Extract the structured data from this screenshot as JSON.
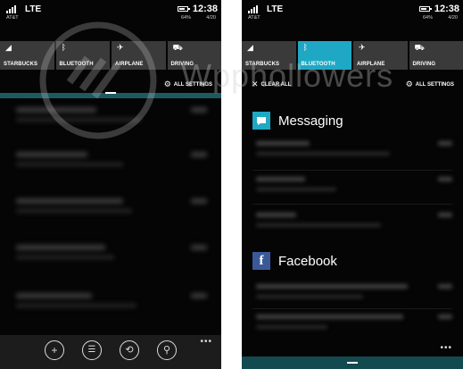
{
  "status": {
    "network": "LTE",
    "carrier": "AT&T",
    "battery_pct": "64%",
    "time": "12:38",
    "date": "4/20"
  },
  "quick_actions": [
    {
      "label": "STARBUCKS",
      "icon": "wifi-icon"
    },
    {
      "label": "BLUETOOTH",
      "icon": "bluetooth-icon"
    },
    {
      "label": "AIRPLANE",
      "icon": "airplane-icon"
    },
    {
      "label": "DRIVING",
      "icon": "car-icon"
    }
  ],
  "all_settings_label": "ALL SETTINGS",
  "clear_all_label": "CLEAR ALL",
  "apps": [
    {
      "title": "Messaging",
      "icon": "messaging-icon",
      "color": "#1fa8c4"
    },
    {
      "title": "Facebook",
      "icon": "facebook-icon",
      "color": "#3b5998"
    }
  ],
  "watermark": "Wpphollowers",
  "colors": {
    "accent": "#1fa8c4",
    "tile": "#3a3a3a",
    "background": "#050505"
  }
}
